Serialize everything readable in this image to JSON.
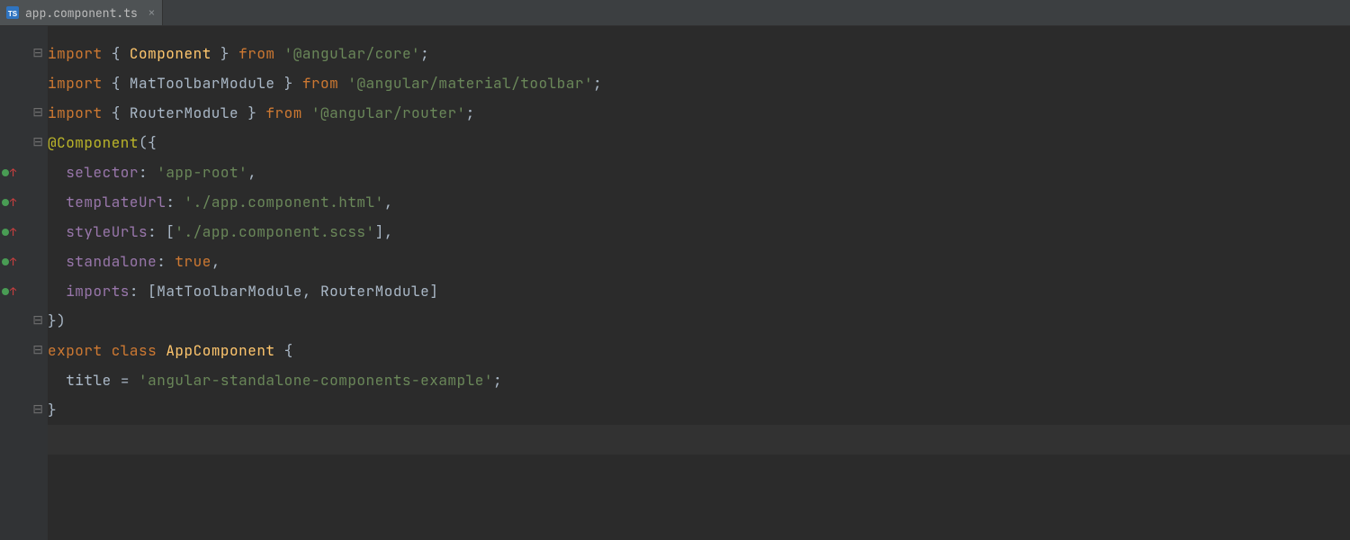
{
  "tab": {
    "filename": "app.component.ts",
    "icon": "ts"
  },
  "gutter": {
    "rows": [
      {
        "fold": "⊟",
        "vcs": false
      },
      {
        "fold": "",
        "vcs": false
      },
      {
        "fold": "⊟",
        "vcs": false
      },
      {
        "fold": "⊟",
        "vcs": false
      },
      {
        "fold": "",
        "vcs": true
      },
      {
        "fold": "",
        "vcs": true
      },
      {
        "fold": "",
        "vcs": true
      },
      {
        "fold": "",
        "vcs": true
      },
      {
        "fold": "",
        "vcs": true
      },
      {
        "fold": "⊟",
        "vcs": false
      },
      {
        "fold": "⊟",
        "vcs": false
      },
      {
        "fold": "",
        "vcs": false
      },
      {
        "fold": "⊟",
        "vcs": false
      },
      {
        "fold": "",
        "vcs": false
      }
    ]
  },
  "code": {
    "l1": {
      "kw1": "import ",
      "p1": "{ ",
      "cls": "Component",
      "p2": " } ",
      "kw2": "from ",
      "str": "'@angular/core'",
      "end": ";"
    },
    "l2": {
      "kw1": "import ",
      "p1": "{ ",
      "id": "MatToolbarModule",
      "p2": " } ",
      "kw2": "from ",
      "str": "'@angular/material/toolbar'",
      "end": ";"
    },
    "l3": {
      "kw1": "import ",
      "p1": "{ ",
      "id": "RouterModule",
      "p2": " } ",
      "kw2": "from ",
      "str": "'@angular/router'",
      "end": ";"
    },
    "l4": {
      "dec": "@Component",
      "open": "({"
    },
    "l5": {
      "indent": "  ",
      "prop": "selector",
      "col": ": ",
      "str": "'app-root'",
      "end": ","
    },
    "l6": {
      "indent": "  ",
      "prop": "templateUrl",
      "col": ": ",
      "str": "'./app.component.html'",
      "end": ","
    },
    "l7": {
      "indent": "  ",
      "prop": "styleUrls",
      "col": ": [",
      "str": "'./app.component.scss'",
      "end": "],"
    },
    "l8": {
      "indent": "  ",
      "prop": "standalone",
      "col": ": ",
      "kw": "true",
      "end": ","
    },
    "l9": {
      "indent": "  ",
      "prop": "imports",
      "col": ": [",
      "id1": "MatToolbarModule",
      "sep": ", ",
      "id2": "RouterModule",
      "end": "]"
    },
    "l10": {
      "close": "})"
    },
    "l11": {
      "kw1": "export ",
      "kw2": "class ",
      "cls": "AppComponent",
      "open": " {"
    },
    "l12": {
      "indent": "  ",
      "id": "title",
      "eq": " = ",
      "str": "'angular-standalone-components-example'",
      "end": ";"
    },
    "l13": {
      "close": "}"
    }
  }
}
